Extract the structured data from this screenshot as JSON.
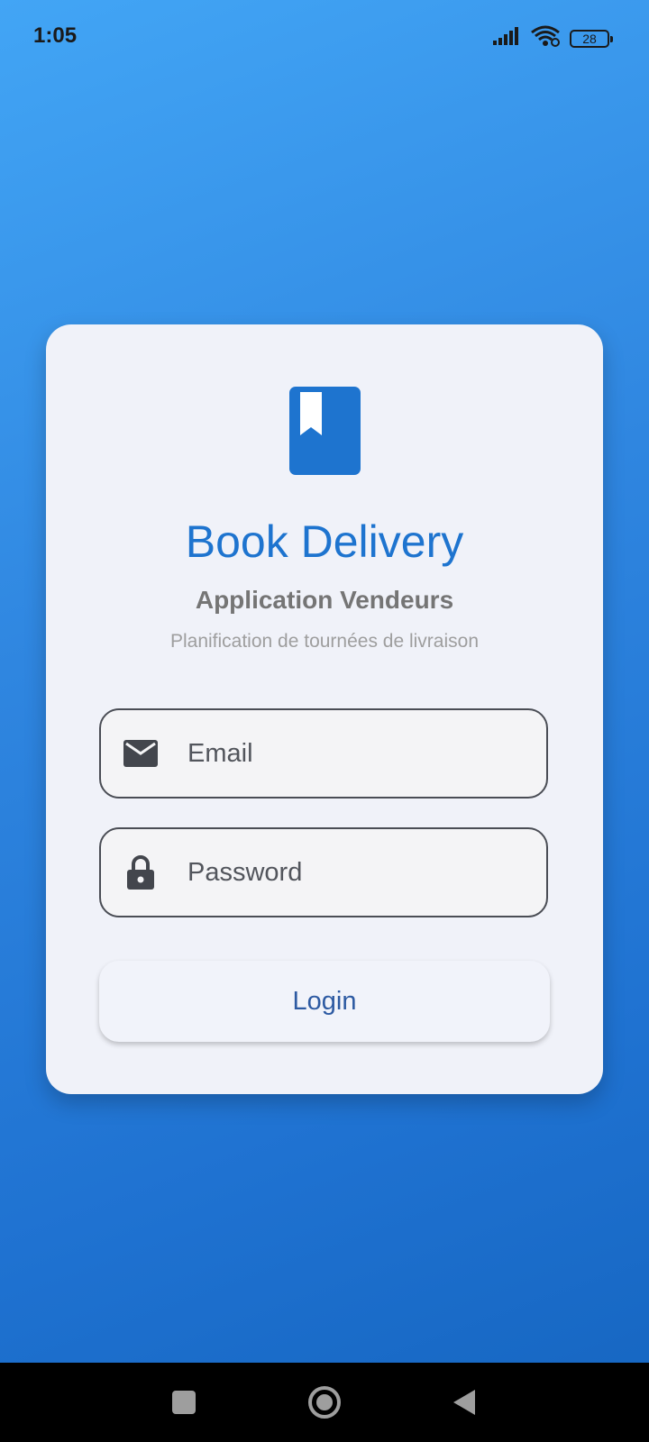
{
  "status_bar": {
    "time": "1:05",
    "battery_level": "28",
    "icons": [
      "signal-icon",
      "wifi-icon",
      "battery-icon"
    ]
  },
  "app": {
    "logo_icon": "book-bookmark-icon",
    "title": "Book Delivery",
    "subtitle": "Application Vendeurs",
    "tagline": "Planification de tournées de livraison"
  },
  "form": {
    "email": {
      "icon": "mail-icon",
      "placeholder": "Email",
      "value": ""
    },
    "password": {
      "icon": "lock-icon",
      "placeholder": "Password",
      "value": ""
    },
    "login_label": "Login"
  },
  "nav": {
    "buttons": [
      "recents-button",
      "home-button",
      "back-button"
    ]
  },
  "colors": {
    "primary": "#1e74cf",
    "gradient_top": "#42a5f5",
    "gradient_bottom": "#1565c0",
    "card_background": "#f0f2f9",
    "button_text": "#2d5aa2"
  }
}
